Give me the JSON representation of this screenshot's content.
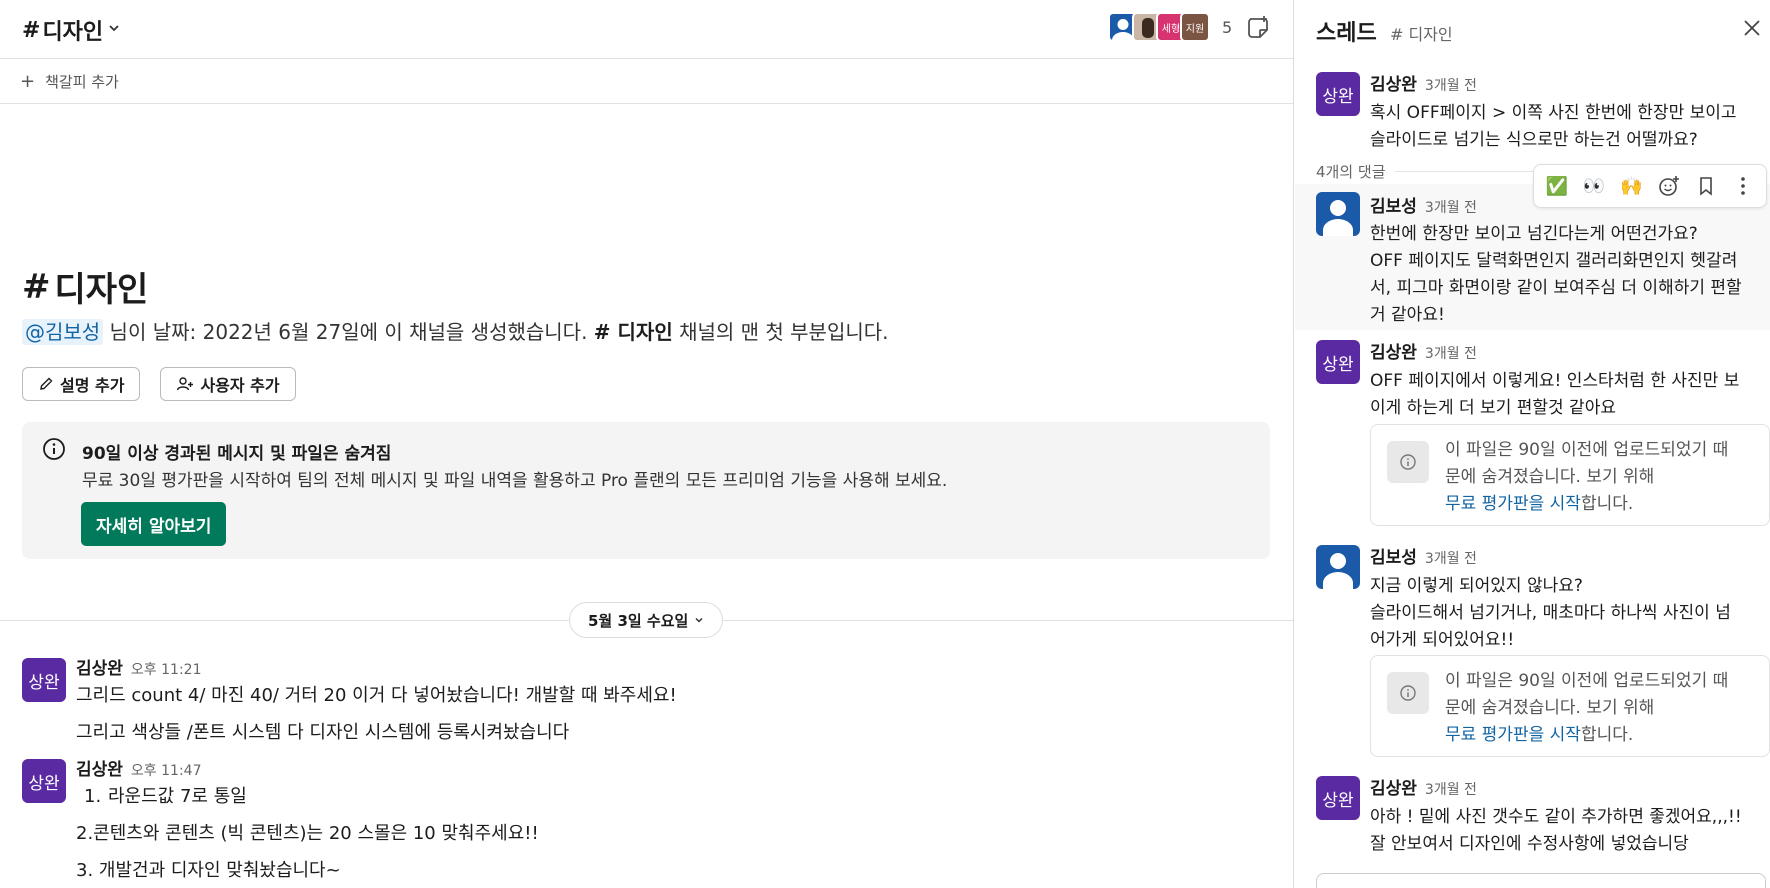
{
  "header": {
    "hash": "#",
    "channel_name": "디자인",
    "member_count": "5",
    "avatar3_label": "세형",
    "avatar4_label": "지원"
  },
  "bookmark_bar": {
    "label": "책갈피 추가"
  },
  "intro": {
    "hash": "#",
    "title": "디자인",
    "mention": "@김보성",
    "desc_part1": " 님이 날짜: 2022년 6월 27일에 이 채널을 생성했습니다. ",
    "desc_channel": "# 디자인",
    "desc_part2": " 채널의 맨 첫 부분입니다.",
    "btn_description": "설명 추가",
    "btn_add_user": "사용자 추가"
  },
  "notice": {
    "title": "90일 이상 경과된 메시지 및 파일은 숨겨짐",
    "body": "무료 30일 평가판을 시작하여 팀의 전체 메시지 및 파일 내역을 활용하고 Pro 플랜의 모든 프리미엄 기능을 사용해 보세요.",
    "button": "자세히 알아보기"
  },
  "date_divider": {
    "label": "5월 3일 수요일"
  },
  "messages": [
    {
      "avatar": "상완",
      "name": "김상완",
      "time": "오후 11:21",
      "lines": [
        "그리드 count 4/ 마진 40/ 거터 20 이거 다 넣어놨습니다! 개발할 때 봐주세요!",
        "그리고 색상들 /폰트 시스템 다 디자인 시스템에 등록시켜놨습니다"
      ]
    },
    {
      "avatar": "상완",
      "name": "김상완",
      "time": "오후 11:47",
      "list_num": "1.",
      "lines": [
        "라운드값 7로 통일",
        "2.콘텐츠와 콘텐츠 (빅 콘텐츠)는 20 스몰은 10 맞춰주세요!!",
        "3. 개발건과 디자인 맞춰놨습니다~"
      ]
    }
  ],
  "thread": {
    "title": "스레드",
    "channel": "# 디자인",
    "reply_count": "4개의 댓글",
    "reactions": [
      "✅",
      "👀",
      "🙌"
    ],
    "hidden_file": {
      "line1": "이 파일은 90일 이전에 업로드되었기 때",
      "line2": "문에 숨겨졌습니다. 보기 위해",
      "link": "무료 평가판을 시작",
      "suffix": "합니다."
    },
    "messages": [
      {
        "avatar": "상완",
        "name": "김상완",
        "time": "3개월 전",
        "lines": [
          "혹시 OFF페이지 > 이쪽 사진 한번에 한장만 보이고",
          "슬라이드로 넘기는 식으로만 하는건 어떨까요?"
        ]
      },
      {
        "name": "김보성",
        "time": "3개월 전",
        "lines": [
          "한번에 한장만 보이고 넘긴다는게 어떤건가요?",
          "OFF 페이지도 달력화면인지 갤러리화면인지 헷갈려",
          "서, 피그마 화면이랑 같이 보여주심 더 이해하기 편할",
          "거 같아요!"
        ]
      },
      {
        "avatar": "상완",
        "name": "김상완",
        "time": "3개월 전",
        "lines": [
          "OFF 페이지에서 이렇게요! 인스타처럼 한 사진만 보",
          "이게 하는게 더 보기 편할것 같아요"
        ]
      },
      {
        "name": "김보성",
        "time": "3개월 전",
        "lines": [
          "지금 이렇게 되어있지 않나요?",
          "슬라이드해서 넘기거나, 매초마다 하나씩 사진이 넘",
          "어가게 되어있어요!!"
        ]
      },
      {
        "avatar": "상완",
        "name": "김상완",
        "time": "3개월 전",
        "lines": [
          "아하 ! 밑에 사진 갯수도 같이 추가하면 좋겠어요,,,!!",
          "잘 안보여서 디자인에 수정사항에 넣었습니당"
        ]
      }
    ]
  },
  "colors": {
    "accent_green": "#007a5a",
    "avatar_purple": "#5a2aa3",
    "avatar_blue": "#1a5aa8",
    "link_blue": "#1264a3"
  }
}
